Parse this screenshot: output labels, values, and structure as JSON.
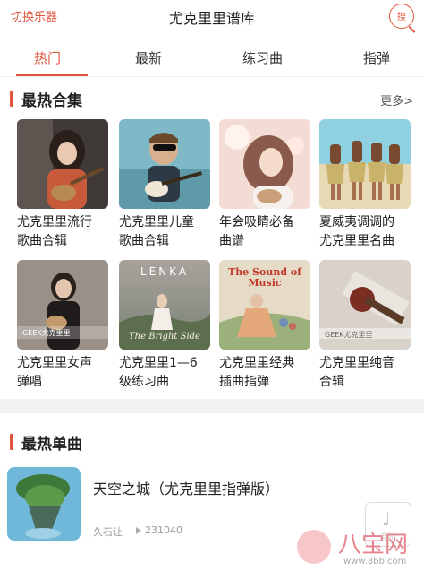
{
  "header": {
    "switch_label": "切换乐器",
    "title": "尤克里里谱库",
    "search_label": "搜"
  },
  "tabs": [
    {
      "label": "热门",
      "active": true
    },
    {
      "label": "最新",
      "active": false
    },
    {
      "label": "练习曲",
      "active": false
    },
    {
      "label": "指弹",
      "active": false
    }
  ],
  "hot_collections": {
    "title": "最热合集",
    "more": "更多>",
    "items": [
      {
        "title": "尤克里里流行\n歌曲合辑"
      },
      {
        "title": "尤克里里儿童\n歌曲合辑"
      },
      {
        "title": "年会吸睛必备\n曲谱"
      },
      {
        "title": "夏威夷调调的\n尤克里里名曲"
      },
      {
        "title": "尤克里里女声\n弹唱",
        "cover_text": "GEEK尤克里里"
      },
      {
        "title": "尤克里里1—6\n级练习曲",
        "cover_text": "LENKA",
        "cover_script": "The Bright Side"
      },
      {
        "title": "尤克里里经典\n插曲指弹",
        "cover_text": "The Sound of Music"
      },
      {
        "title": "尤克里里纯音\n合辑",
        "cover_text": "GEEK尤克里里"
      }
    ]
  },
  "hot_singles": {
    "title": "最热单曲",
    "items": [
      {
        "title": "天空之城（尤克里里指弹版）",
        "artist": "久石让",
        "plays": "231040"
      }
    ]
  },
  "floating": {
    "note_label": "音阶"
  },
  "watermark": {
    "brand": "八宝网",
    "url": "www.8bb.com"
  }
}
